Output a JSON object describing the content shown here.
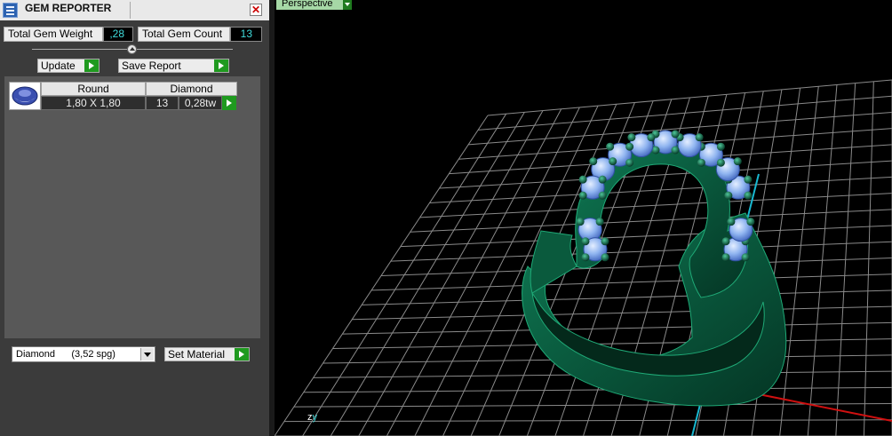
{
  "panel": {
    "title": "GEM REPORTER",
    "total_weight_label": "Total Gem Weight",
    "total_weight_value": ",28",
    "total_count_label": "Total Gem Count",
    "total_count_value": "13",
    "update_label": "Update",
    "save_report_label": "Save Report",
    "gem_table": {
      "headers": [
        "Round",
        "Diamond"
      ],
      "row": {
        "size": "1,80 X 1,80",
        "count": "13",
        "weight": "0,28tw"
      }
    },
    "material_select": {
      "value": "Diamond      (3,52 spg)"
    },
    "set_material_label": "Set Material",
    "colors": {
      "value_text": "#3fdcdc",
      "action_green": "#1f9a1f",
      "panel_bg": "#3b3b3b"
    }
  },
  "viewport": {
    "view_mode": "Perspective",
    "axis_labels": {
      "z": "z",
      "y": "y"
    },
    "colors": {
      "grid": "#8a8a8a",
      "ring_metal": "#0b5a3f",
      "gem": "#8fb4f0",
      "x_axis": "#d01010",
      "y_axis": "#18b8d0"
    }
  },
  "icons": [
    "gem-reporter-icon",
    "close-icon",
    "slider-knob-icon",
    "play-arrow-icon",
    "dropdown-arrow-icon",
    "round-gem-icon"
  ]
}
